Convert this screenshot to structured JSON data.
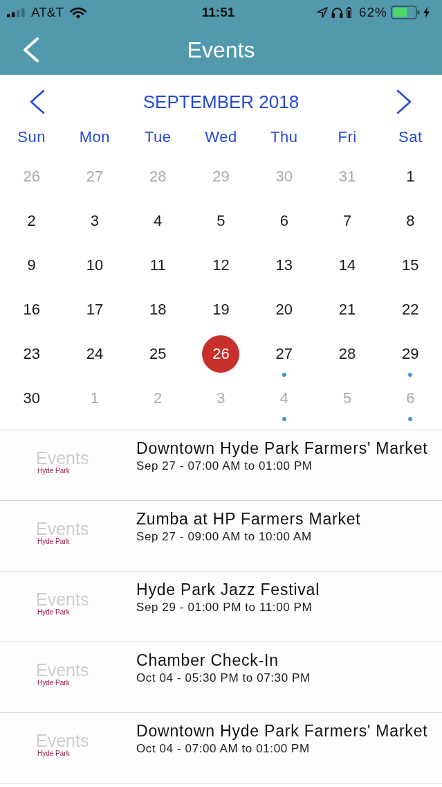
{
  "status_bar": {
    "carrier": "AT&T",
    "time": "11:51",
    "battery": "62%",
    "charging": true
  },
  "nav_bar": {
    "title": "Events"
  },
  "calendar": {
    "month": "SEPTEMBER 2018",
    "weekdays": [
      "Sun",
      "Mon",
      "Tue",
      "Wed",
      "Thu",
      "Fri",
      "Sat"
    ],
    "days": [
      {
        "label": "26",
        "outside": true,
        "selected": false,
        "has_event": false
      },
      {
        "label": "27",
        "outside": true,
        "selected": false,
        "has_event": false
      },
      {
        "label": "28",
        "outside": true,
        "selected": false,
        "has_event": false
      },
      {
        "label": "29",
        "outside": true,
        "selected": false,
        "has_event": false
      },
      {
        "label": "30",
        "outside": true,
        "selected": false,
        "has_event": false
      },
      {
        "label": "31",
        "outside": true,
        "selected": false,
        "has_event": false
      },
      {
        "label": "1",
        "outside": false,
        "selected": false,
        "has_event": false
      },
      {
        "label": "2",
        "outside": false,
        "selected": false,
        "has_event": false
      },
      {
        "label": "3",
        "outside": false,
        "selected": false,
        "has_event": false
      },
      {
        "label": "4",
        "outside": false,
        "selected": false,
        "has_event": false
      },
      {
        "label": "5",
        "outside": false,
        "selected": false,
        "has_event": false
      },
      {
        "label": "6",
        "outside": false,
        "selected": false,
        "has_event": false
      },
      {
        "label": "7",
        "outside": false,
        "selected": false,
        "has_event": false
      },
      {
        "label": "8",
        "outside": false,
        "selected": false,
        "has_event": false
      },
      {
        "label": "9",
        "outside": false,
        "selected": false,
        "has_event": false
      },
      {
        "label": "10",
        "outside": false,
        "selected": false,
        "has_event": false
      },
      {
        "label": "11",
        "outside": false,
        "selected": false,
        "has_event": false
      },
      {
        "label": "12",
        "outside": false,
        "selected": false,
        "has_event": false
      },
      {
        "label": "13",
        "outside": false,
        "selected": false,
        "has_event": false
      },
      {
        "label": "14",
        "outside": false,
        "selected": false,
        "has_event": false
      },
      {
        "label": "15",
        "outside": false,
        "selected": false,
        "has_event": false
      },
      {
        "label": "16",
        "outside": false,
        "selected": false,
        "has_event": false
      },
      {
        "label": "17",
        "outside": false,
        "selected": false,
        "has_event": false
      },
      {
        "label": "18",
        "outside": false,
        "selected": false,
        "has_event": false
      },
      {
        "label": "19",
        "outside": false,
        "selected": false,
        "has_event": false
      },
      {
        "label": "20",
        "outside": false,
        "selected": false,
        "has_event": false
      },
      {
        "label": "21",
        "outside": false,
        "selected": false,
        "has_event": false
      },
      {
        "label": "22",
        "outside": false,
        "selected": false,
        "has_event": false
      },
      {
        "label": "23",
        "outside": false,
        "selected": false,
        "has_event": false
      },
      {
        "label": "24",
        "outside": false,
        "selected": false,
        "has_event": false
      },
      {
        "label": "25",
        "outside": false,
        "selected": false,
        "has_event": false
      },
      {
        "label": "26",
        "outside": false,
        "selected": true,
        "has_event": false
      },
      {
        "label": "27",
        "outside": false,
        "selected": false,
        "has_event": true
      },
      {
        "label": "28",
        "outside": false,
        "selected": false,
        "has_event": false
      },
      {
        "label": "29",
        "outside": false,
        "selected": false,
        "has_event": true
      },
      {
        "label": "30",
        "outside": false,
        "selected": false,
        "has_event": false
      },
      {
        "label": "1",
        "outside": true,
        "selected": false,
        "has_event": false
      },
      {
        "label": "2",
        "outside": true,
        "selected": false,
        "has_event": false
      },
      {
        "label": "3",
        "outside": true,
        "selected": false,
        "has_event": false
      },
      {
        "label": "4",
        "outside": true,
        "selected": false,
        "has_event": true
      },
      {
        "label": "5",
        "outside": true,
        "selected": false,
        "has_event": false
      },
      {
        "label": "6",
        "outside": true,
        "selected": false,
        "has_event": true
      }
    ]
  },
  "events": [
    {
      "logo_title": "Events",
      "logo_subtitle": "Hyde Park",
      "title": "Downtown Hyde Park Farmers' Market",
      "time": "Sep 27 - 07:00 AM to 01:00 PM"
    },
    {
      "logo_title": "Events",
      "logo_subtitle": "Hyde Park",
      "title": "Zumba at HP Farmers Market",
      "time": "Sep 27 - 09:00 AM to 10:00 AM"
    },
    {
      "logo_title": "Events",
      "logo_subtitle": "Hyde Park",
      "title": "Hyde Park Jazz Festival",
      "time": "Sep 29 - 01:00 PM to 11:00 PM"
    },
    {
      "logo_title": "Events",
      "logo_subtitle": "Hyde Park",
      "title": "Chamber Check-In",
      "time": "Oct 04 - 05:30 PM to 07:30 PM"
    },
    {
      "logo_title": "Events",
      "logo_subtitle": "Hyde Park",
      "title": "Downtown Hyde Park Farmers' Market",
      "time": "Oct 04 - 07:00 AM to 01:00 PM"
    }
  ]
}
